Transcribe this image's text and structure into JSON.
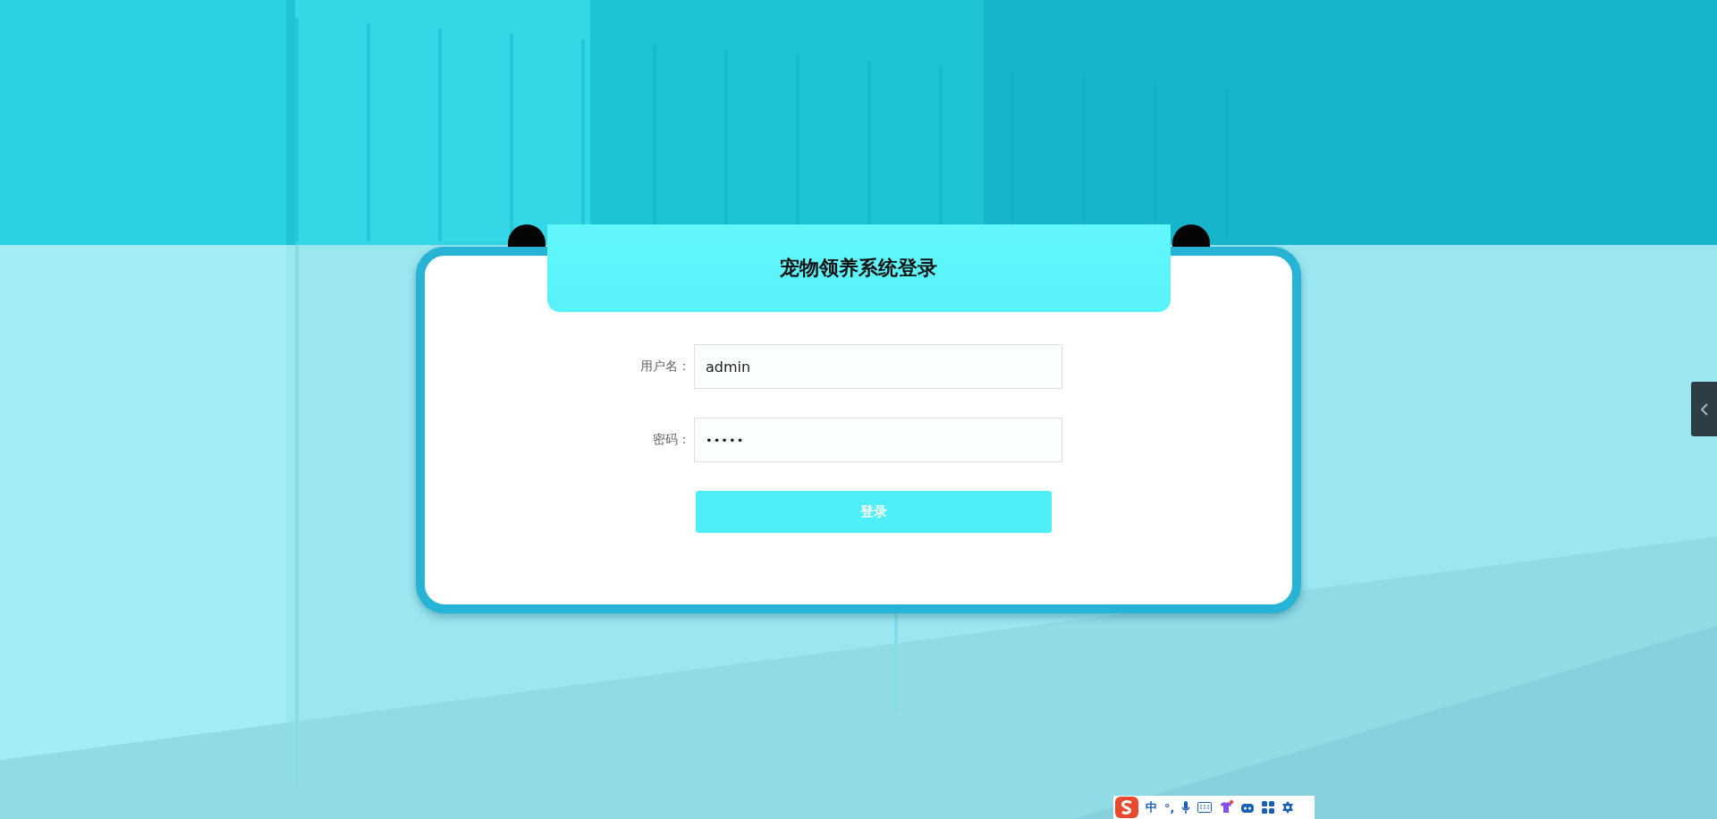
{
  "login": {
    "title": "宠物领养系统登录",
    "fields": [
      {
        "kind": "text",
        "label": "用户名：",
        "value": "admin"
      },
      {
        "kind": "password",
        "label": "密码：",
        "value": "•••••"
      }
    ],
    "submit": "登录"
  },
  "ime_bar": {
    "mode": "中",
    "punctuation": "°,"
  }
}
